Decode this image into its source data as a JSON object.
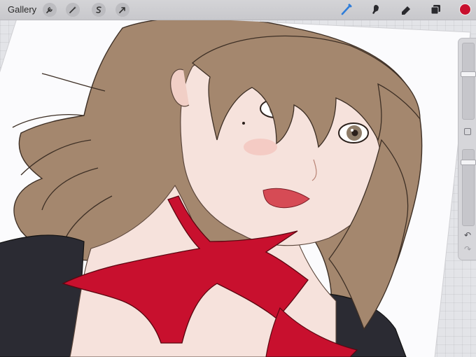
{
  "toolbar": {
    "gallery_label": "Gallery",
    "left_tools": [
      "wrench-icon",
      "magic-wand-icon",
      "selection-s-icon",
      "transform-arrow-icon"
    ],
    "right_tools": [
      "brush-icon",
      "smudge-icon",
      "eraser-icon",
      "layers-icon"
    ],
    "active_tool": "brush-icon",
    "active_color": "#c8102e",
    "brush_color_accent": "#2f7dd9"
  },
  "sidebar": {
    "size_slider_level": 0.3,
    "opacity_slider_level": 0.15,
    "undo_icon": "undo-icon",
    "redo_icon": "redo-icon"
  },
  "canvas": {
    "artwork": "illustration",
    "colors": {
      "hair": "#a4876e",
      "hair_dark": "#6a5443",
      "skin": "#f6e2dc",
      "scarf": "#c8102e",
      "dress": "#2b2b33",
      "paper": "#fbfbfd"
    }
  }
}
